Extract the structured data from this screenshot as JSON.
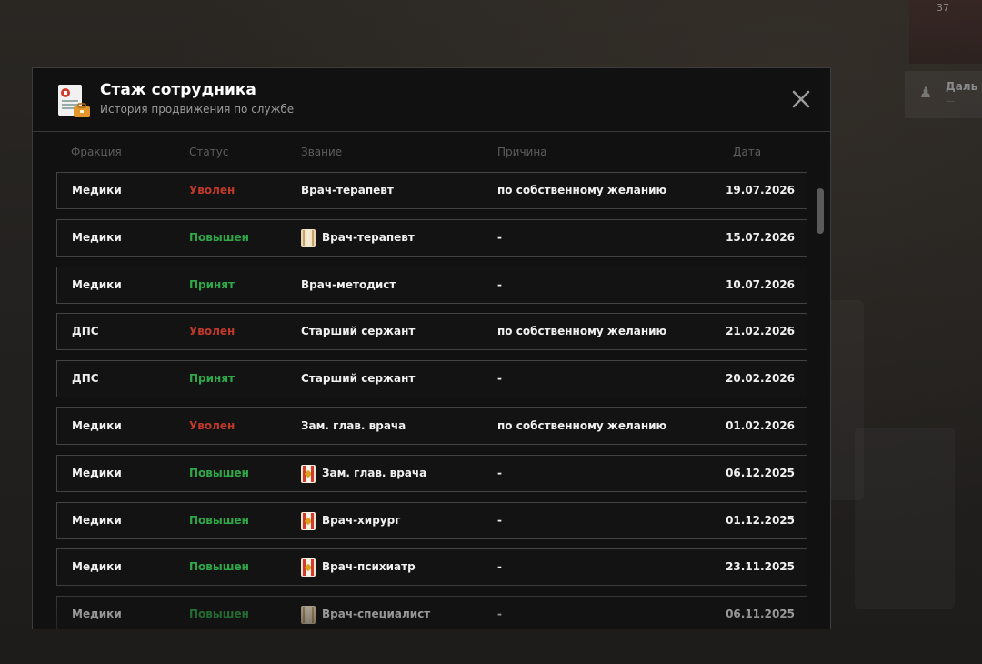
{
  "hud": {
    "top_text": "37",
    "panel_label": "Даль",
    "panel_sub": "—"
  },
  "modal": {
    "title": "Стаж сотрудника",
    "subtitle": "История продвижения по службе"
  },
  "columns": {
    "faction": "Фракция",
    "status": "Статус",
    "rank": "Звание",
    "reason": "Причина",
    "date": "Дата"
  },
  "colors": {
    "status_fired": "#c0392b",
    "status_promoted": "#2fa84a",
    "status_accepted": "#2fa84a"
  },
  "rows": [
    {
      "faction": "Медики",
      "status": "Уволен",
      "status_type": "fired",
      "rank": "Врач-терапевт",
      "badge": "",
      "reason": "по собственному желанию",
      "date": "19.07.2026"
    },
    {
      "faction": "Медики",
      "status": "Повышен",
      "status_type": "promoted",
      "rank": "Врач-терапевт",
      "badge": "beige",
      "reason": "-",
      "date": "15.07.2026"
    },
    {
      "faction": "Медики",
      "status": "Принят",
      "status_type": "accepted",
      "rank": "Врач-методист",
      "badge": "",
      "reason": "-",
      "date": "10.07.2026"
    },
    {
      "faction": "ДПС",
      "status": "Уволен",
      "status_type": "fired",
      "rank": "Старший сержант",
      "badge": "",
      "reason": "по собственному желанию",
      "date": "21.02.2026"
    },
    {
      "faction": "ДПС",
      "status": "Принят",
      "status_type": "accepted",
      "rank": "Старший сержант",
      "badge": "",
      "reason": "-",
      "date": "20.02.2026"
    },
    {
      "faction": "Медики",
      "status": "Уволен",
      "status_type": "fired",
      "rank": "Зам. глав. врача",
      "badge": "",
      "reason": "по собственному желанию",
      "date": "01.02.2026"
    },
    {
      "faction": "Медики",
      "status": "Повышен",
      "status_type": "promoted",
      "rank": "Зам. глав. врача",
      "badge": "red",
      "reason": "-",
      "date": "06.12.2025"
    },
    {
      "faction": "Медики",
      "status": "Повышен",
      "status_type": "promoted",
      "rank": "Врач-хирург",
      "badge": "red",
      "reason": "-",
      "date": "01.12.2025"
    },
    {
      "faction": "Медики",
      "status": "Повышен",
      "status_type": "promoted",
      "rank": "Врач-психиатр",
      "badge": "red",
      "reason": "-",
      "date": "23.11.2025"
    },
    {
      "faction": "Медики",
      "status": "Повышен",
      "status_type": "promoted",
      "rank": "Врач-специалист",
      "badge": "beige",
      "reason": "-",
      "date": "06.11.2025"
    }
  ]
}
